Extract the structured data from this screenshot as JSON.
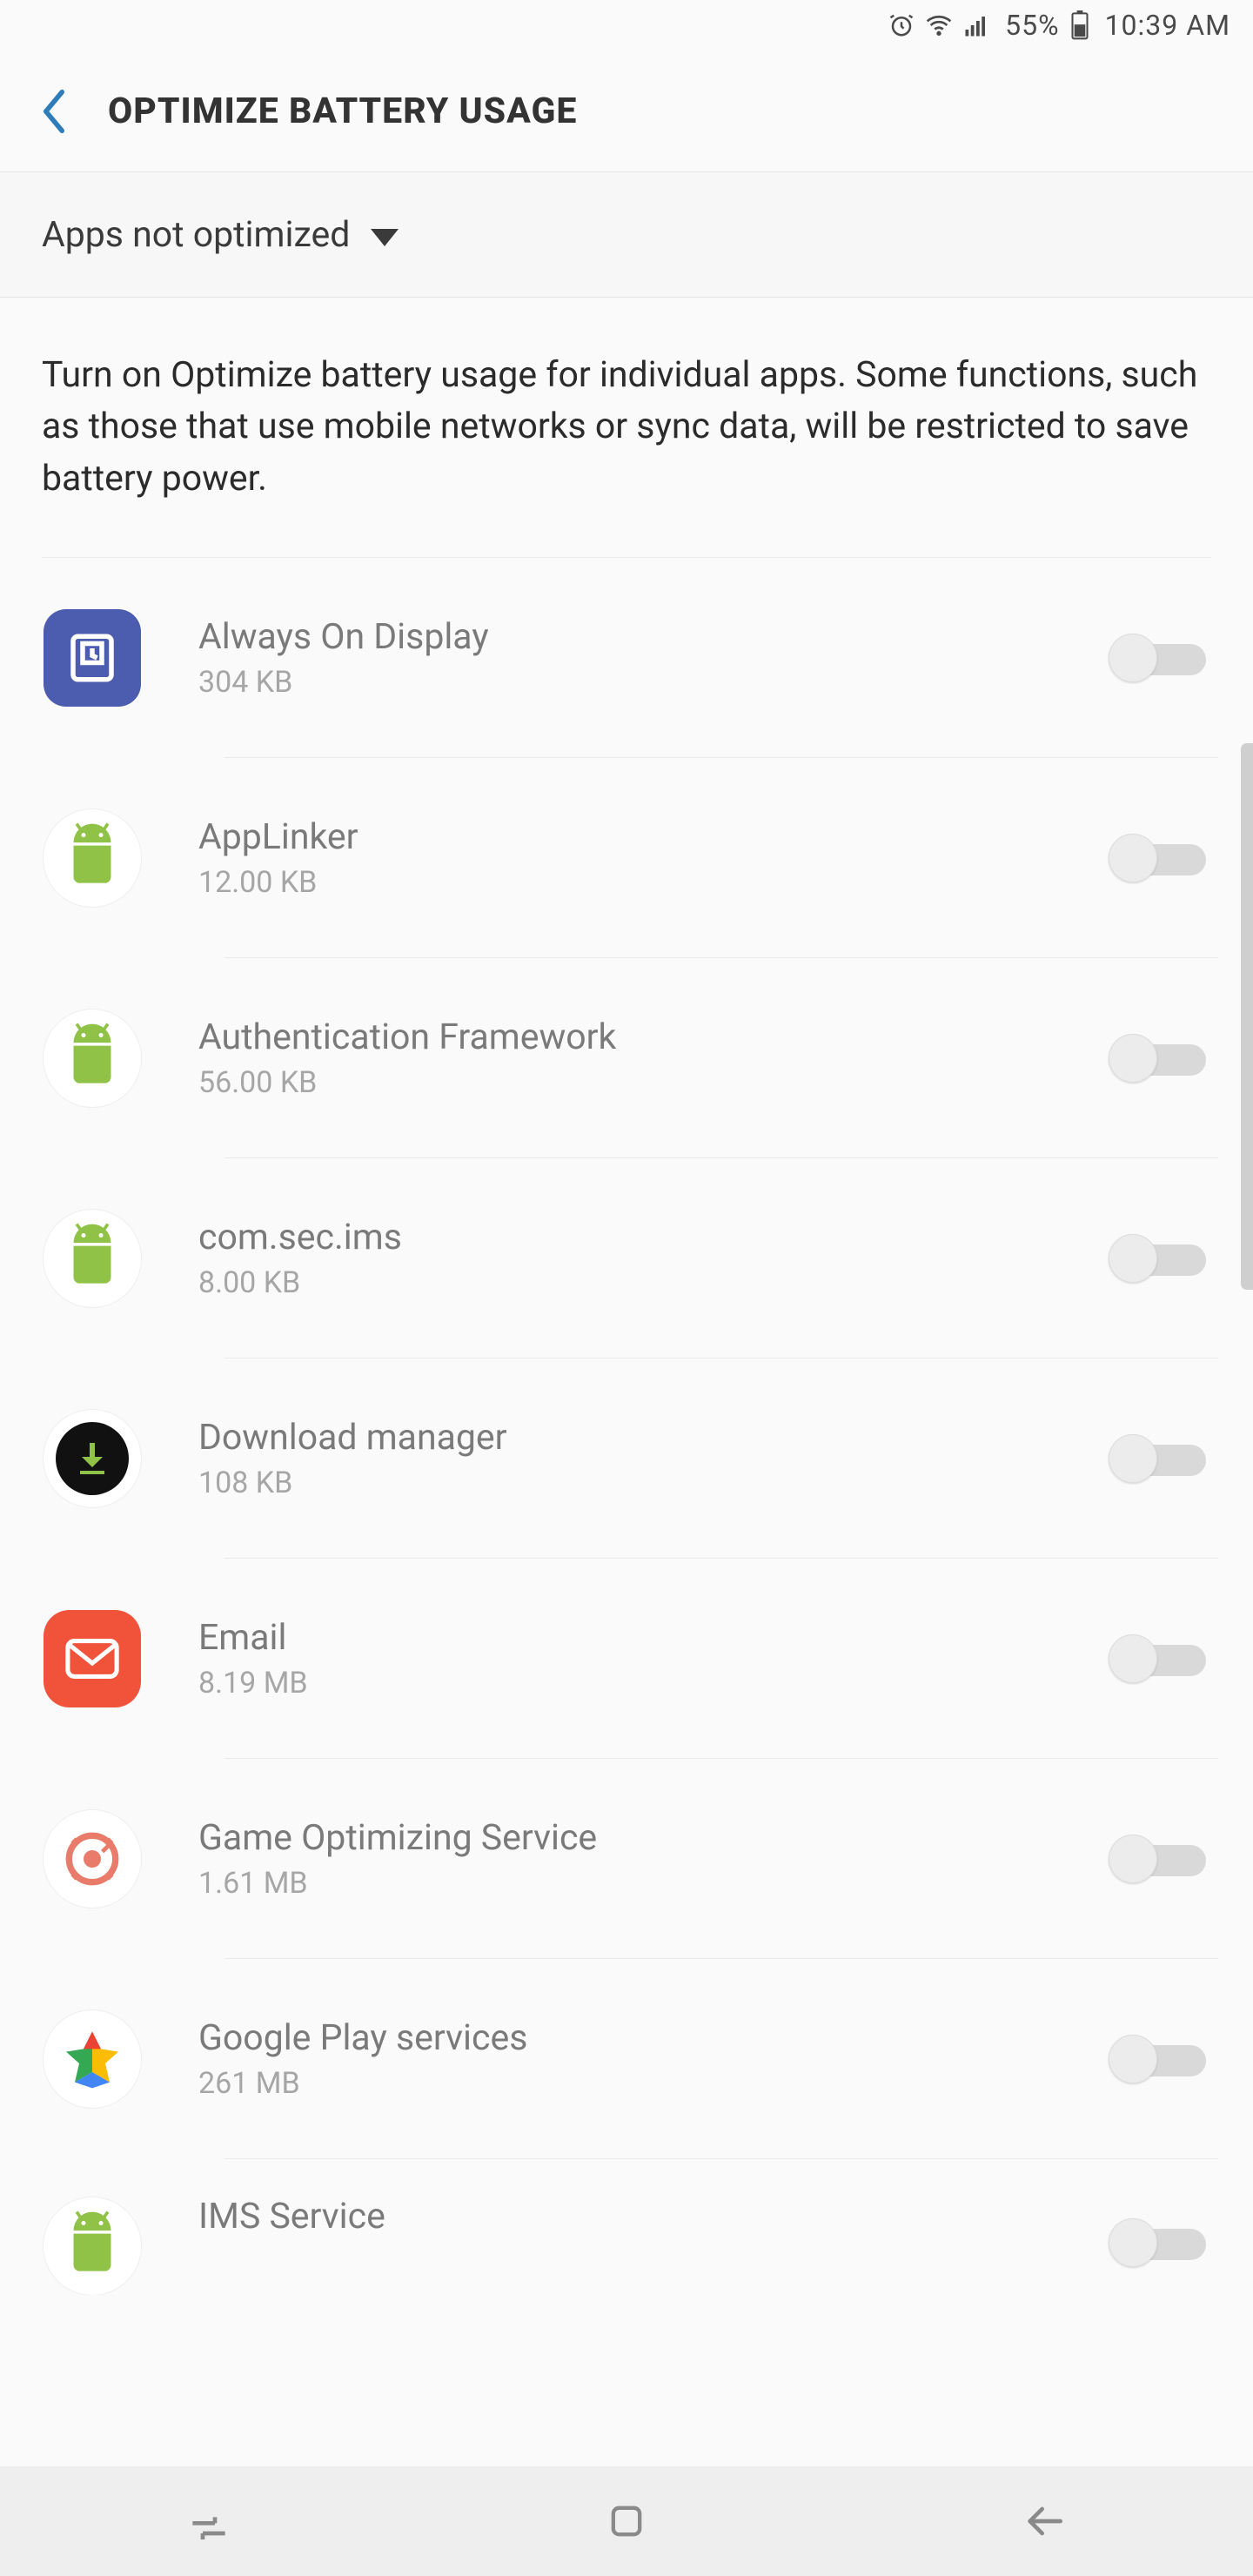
{
  "status": {
    "battery_pct": "55%",
    "time": "10:39 AM"
  },
  "header": {
    "title": "OPTIMIZE BATTERY USAGE"
  },
  "filter": {
    "label": "Apps not optimized"
  },
  "description": "Turn on Optimize battery usage for individual apps. Some functions, such as those that use mobile networks or sync data, will be restricted to save battery power.",
  "apps": [
    {
      "name": "Always On Display",
      "size": "304 KB",
      "icon": "aod",
      "toggle": false
    },
    {
      "name": "AppLinker",
      "size": "12.00 KB",
      "icon": "android",
      "toggle": false
    },
    {
      "name": "Authentication Framework",
      "size": "56.00 KB",
      "icon": "android",
      "toggle": false
    },
    {
      "name": "com.sec.ims",
      "size": "8.00 KB",
      "icon": "android",
      "toggle": false
    },
    {
      "name": "Download manager",
      "size": "108 KB",
      "icon": "download",
      "toggle": false
    },
    {
      "name": "Email",
      "size": "8.19 MB",
      "icon": "email",
      "toggle": false
    },
    {
      "name": "Game Optimizing Service",
      "size": "1.61 MB",
      "icon": "game-opt",
      "toggle": false
    },
    {
      "name": "Google Play services",
      "size": "261 MB",
      "icon": "play-services",
      "toggle": false
    },
    {
      "name": "IMS Service",
      "size": "",
      "icon": "android",
      "toggle": false
    }
  ]
}
